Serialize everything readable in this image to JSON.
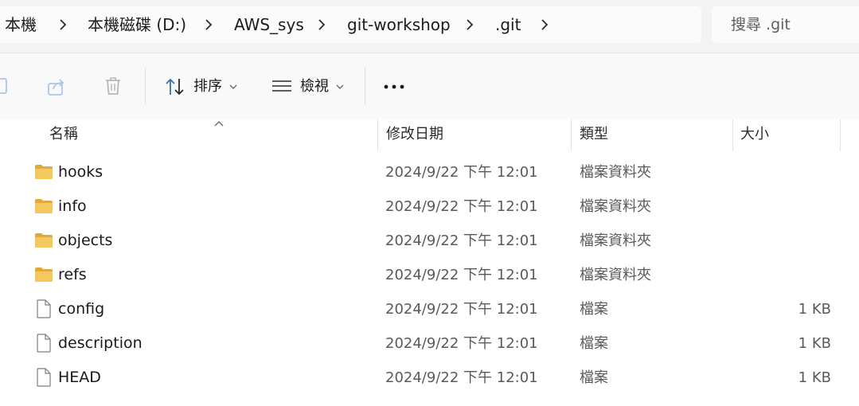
{
  "breadcrumb": {
    "items": [
      "本機",
      "本機磁碟 (D:)",
      "AWS_sys",
      "git-workshop",
      ".git"
    ]
  },
  "search": {
    "placeholder": "搜尋 .git"
  },
  "commandbar": {
    "sort_label": "排序",
    "view_label": "檢視"
  },
  "columns": {
    "name": "名稱",
    "modified": "修改日期",
    "type": "類型",
    "size": "大小"
  },
  "files": [
    {
      "name": "hooks",
      "modified": "2024/9/22 下午 12:01",
      "type": "檔案資料夾",
      "size": "",
      "icon": "folder-icon"
    },
    {
      "name": "info",
      "modified": "2024/9/22 下午 12:01",
      "type": "檔案資料夾",
      "size": "",
      "icon": "folder-icon"
    },
    {
      "name": "objects",
      "modified": "2024/9/22 下午 12:01",
      "type": "檔案資料夾",
      "size": "",
      "icon": "folder-icon"
    },
    {
      "name": "refs",
      "modified": "2024/9/22 下午 12:01",
      "type": "檔案資料夾",
      "size": "",
      "icon": "folder-icon"
    },
    {
      "name": "config",
      "modified": "2024/9/22 下午 12:01",
      "type": "檔案",
      "size": "1 KB",
      "icon": "file-icon"
    },
    {
      "name": "description",
      "modified": "2024/9/22 下午 12:01",
      "type": "檔案",
      "size": "1 KB",
      "icon": "file-icon"
    },
    {
      "name": "HEAD",
      "modified": "2024/9/22 下午 12:01",
      "type": "檔案",
      "size": "1 KB",
      "icon": "file-icon"
    }
  ],
  "colors": {
    "folder": "#f3c85f",
    "folder_dark": "#e0a93a",
    "icon_gray": "#7d7d7d"
  }
}
